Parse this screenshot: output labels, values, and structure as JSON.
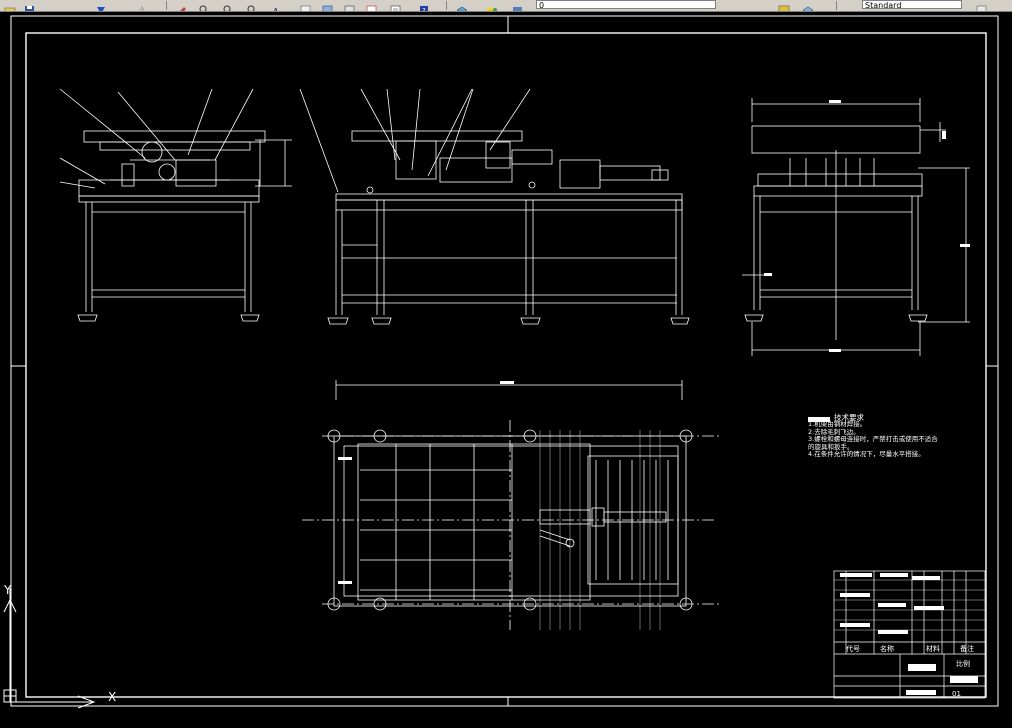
{
  "toolbar": {
    "layer_combo_value": "0",
    "textstyle_combo_value": "Standard",
    "icons": [
      "open-icon",
      "save-icon",
      "arrow-down-icon",
      "undo-icon",
      "paint-icon",
      "zoom-icon",
      "zoom-window-icon",
      "zoom-previous-icon",
      "text-icon",
      "properties-icon",
      "designcenter-icon",
      "toolpalette-icon",
      "calculator-icon",
      "help-icon",
      "layers-icon",
      "layer-state-icon",
      "textstyle-icon",
      "dimstyle-icon"
    ]
  },
  "drawing": {
    "tech_requirements": {
      "heading": "技术要求",
      "items": [
        "1.机架由钢材焊接。",
        "2.去除毛刺飞边。",
        "3.螺栓和螺母连接时，严禁打击或使用不适合",
        "的旋具和扳手。",
        "4.在条件允许的情况下，尽量水平搭接。"
      ]
    },
    "title_block": {
      "header_cells": [
        "代号",
        "名称",
        "材料",
        "备注"
      ],
      "scale_label": "比例",
      "code_label": "01"
    },
    "ucs": {
      "x_label": "X",
      "y_label": "Y"
    }
  },
  "colors": {
    "background": "#000000",
    "lines": "#ffffff",
    "toolbar": "#d4d0c8"
  }
}
